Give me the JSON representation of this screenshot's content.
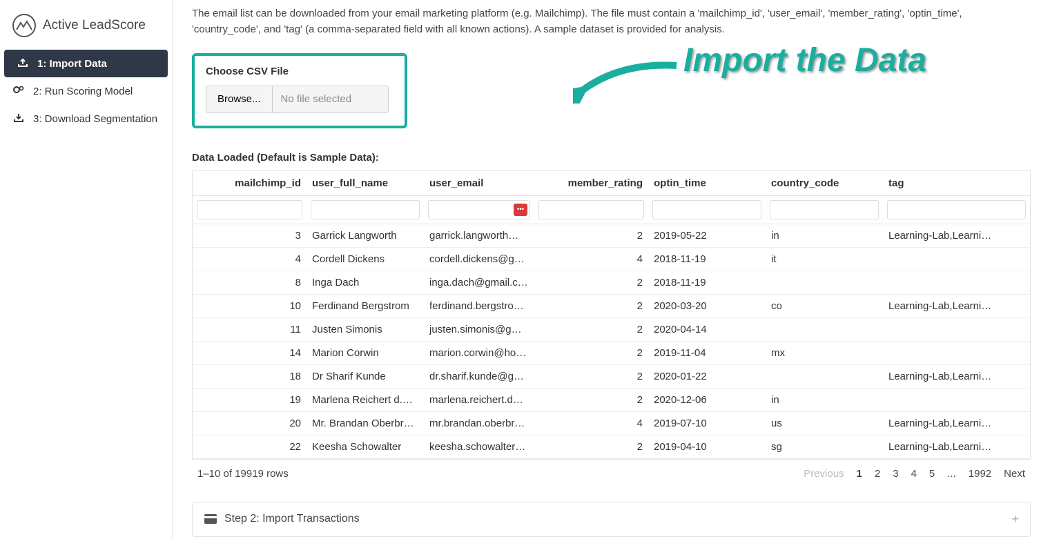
{
  "brand": {
    "title": "Active LeadScore"
  },
  "nav": {
    "items": [
      {
        "label": "1: Import Data",
        "icon": "upload"
      },
      {
        "label": "2: Run Scoring Model",
        "icon": "gears"
      },
      {
        "label": "3: Download Segmentation",
        "icon": "download"
      }
    ]
  },
  "intro": "The email list can be downloaded from your email marketing platform (e.g. Mailchimp). The file must contain a 'mailchimp_id', 'user_email', 'member_rating', 'optin_time', 'country_code', and 'tag' (a comma-separated field with all known actions). A sample dataset is provided for analysis.",
  "upload": {
    "label": "Choose CSV File",
    "browse": "Browse...",
    "placeholder": "No file selected"
  },
  "annotation": "Import the Data",
  "dataLoaded": {
    "title": "Data Loaded (Default is Sample Data):",
    "headers": [
      "mailchimp_id",
      "user_full_name",
      "user_email",
      "member_rating",
      "optin_time",
      "country_code",
      "tag"
    ],
    "rows": [
      {
        "mailchimp_id": "3",
        "user_full_name": "Garrick Langworth",
        "user_email": "garrick.langworth@g…",
        "member_rating": "2",
        "optin_time": "2019-05-22",
        "country_code": "in",
        "tag": "Learning-Lab,Learni…"
      },
      {
        "mailchimp_id": "4",
        "user_full_name": "Cordell Dickens",
        "user_email": "cordell.dickens@gm…",
        "member_rating": "4",
        "optin_time": "2018-11-19",
        "country_code": "it",
        "tag": ""
      },
      {
        "mailchimp_id": "8",
        "user_full_name": "Inga Dach",
        "user_email": "inga.dach@gmail.com",
        "member_rating": "2",
        "optin_time": "2018-11-19",
        "country_code": "",
        "tag": ""
      },
      {
        "mailchimp_id": "10",
        "user_full_name": "Ferdinand Bergstrom",
        "user_email": "ferdinand.bergstrom…",
        "member_rating": "2",
        "optin_time": "2020-03-20",
        "country_code": "co",
        "tag": "Learning-Lab,Learni…"
      },
      {
        "mailchimp_id": "11",
        "user_full_name": "Justen Simonis",
        "user_email": "justen.simonis@gma…",
        "member_rating": "2",
        "optin_time": "2020-04-14",
        "country_code": "",
        "tag": ""
      },
      {
        "mailchimp_id": "14",
        "user_full_name": "Marion Corwin",
        "user_email": "marion.corwin@hot…",
        "member_rating": "2",
        "optin_time": "2019-11-04",
        "country_code": "mx",
        "tag": ""
      },
      {
        "mailchimp_id": "18",
        "user_full_name": "Dr Sharif Kunde",
        "user_email": "dr.sharif.kunde@gm…",
        "member_rating": "2",
        "optin_time": "2020-01-22",
        "country_code": "",
        "tag": "Learning-Lab,Learni…"
      },
      {
        "mailchimp_id": "19",
        "user_full_name": "Marlena Reichert d.d.s.",
        "user_email": "marlena.reichert.dds…",
        "member_rating": "2",
        "optin_time": "2020-12-06",
        "country_code": "in",
        "tag": ""
      },
      {
        "mailchimp_id": "20",
        "user_full_name": "Mr. Brandan Oberbru…",
        "user_email": "mr.brandan.oberbru…",
        "member_rating": "4",
        "optin_time": "2019-07-10",
        "country_code": "us",
        "tag": "Learning-Lab,Learni…"
      },
      {
        "mailchimp_id": "22",
        "user_full_name": "Keesha Schowalter",
        "user_email": "keesha.schowalter@…",
        "member_rating": "2",
        "optin_time": "2019-04-10",
        "country_code": "sg",
        "tag": "Learning-Lab,Learni…"
      }
    ]
  },
  "pager": {
    "summary": "1–10 of 19919 rows",
    "previous": "Previous",
    "next": "Next",
    "pages": [
      "1",
      "2",
      "3",
      "4",
      "5",
      "...",
      "1992"
    ],
    "current": "1"
  },
  "step2": {
    "label": "Step 2: Import Transactions"
  }
}
